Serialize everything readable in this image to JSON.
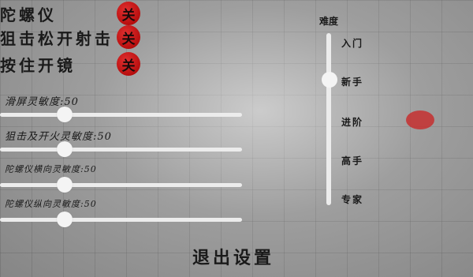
{
  "toggles": [
    {
      "label": "陀螺仪",
      "state": "关"
    },
    {
      "label": "狙击松开射击",
      "state": "关"
    },
    {
      "label": "按住开镜",
      "state": "关"
    }
  ],
  "sliders": [
    {
      "label": "滑屏灵敏度:50",
      "value": 50
    },
    {
      "label": "狙击及开火灵敏度:50",
      "value": 50
    },
    {
      "label": "陀螺仪横向灵敏度:50",
      "value": 50
    },
    {
      "label": "陀螺仪纵向灵敏度:50",
      "value": 50
    }
  ],
  "difficulty": {
    "title": "难度",
    "levels": [
      "入门",
      "新手",
      "进阶",
      "高手",
      "专家"
    ],
    "selected": "新手"
  },
  "exit_label": "退出设置",
  "colors": {
    "toggle_off": "#c01414",
    "marker": "#c82828"
  }
}
